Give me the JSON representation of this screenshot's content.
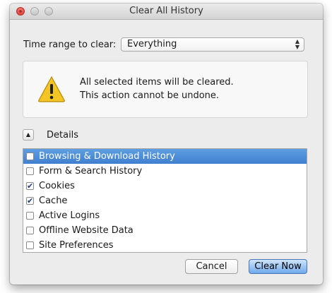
{
  "window": {
    "title": "Clear All History"
  },
  "time_range": {
    "label": "Time range to clear:",
    "selected": "Everything"
  },
  "warning": {
    "icon": "warning-triangle-icon",
    "line1": "All selected items will be cleared.",
    "line2": "This action cannot be undone."
  },
  "details": {
    "label": "Details",
    "items": [
      {
        "label": "Browsing & Download History",
        "checked": false,
        "selected": true
      },
      {
        "label": "Form & Search History",
        "checked": false,
        "selected": false
      },
      {
        "label": "Cookies",
        "checked": true,
        "selected": false
      },
      {
        "label": "Cache",
        "checked": true,
        "selected": false
      },
      {
        "label": "Active Logins",
        "checked": false,
        "selected": false
      },
      {
        "label": "Offline Website Data",
        "checked": false,
        "selected": false
      },
      {
        "label": "Site Preferences",
        "checked": false,
        "selected": false
      }
    ]
  },
  "buttons": {
    "cancel": "Cancel",
    "clear_now": "Clear Now"
  },
  "colors": {
    "selection": "#3f7fd0",
    "default_button": "#6fa9ec",
    "warning_yellow": "#f3c623"
  }
}
